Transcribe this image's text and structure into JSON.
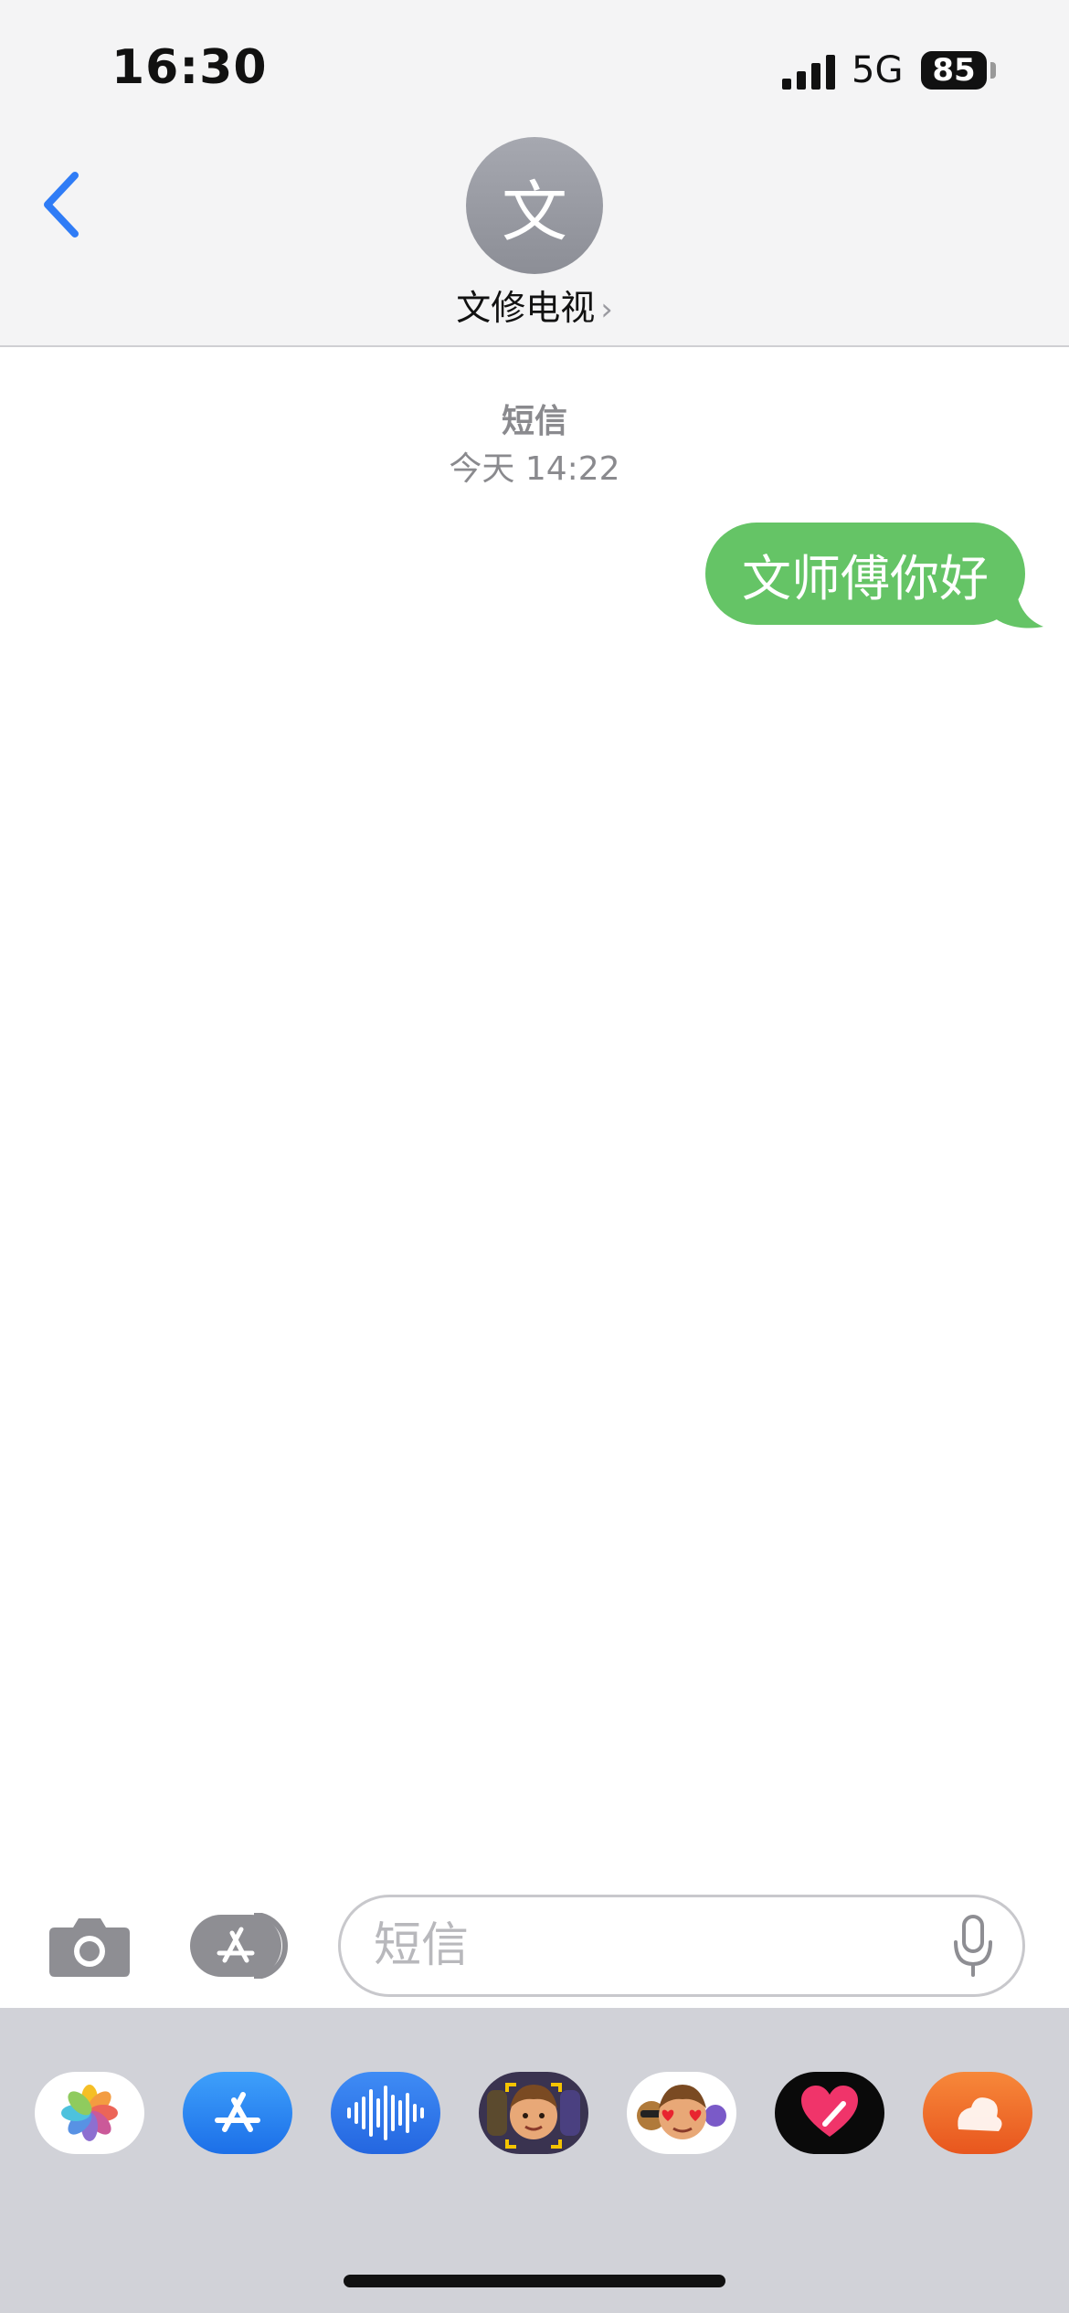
{
  "status": {
    "time": "16:30",
    "network": "5G",
    "battery": "85"
  },
  "contact": {
    "avatar_letter": "文",
    "name": "文修电视",
    "chevron": "›"
  },
  "thread": {
    "type": "短信",
    "timestamp": "今天 14:22"
  },
  "messages": [
    {
      "sender": "me",
      "text": "文师傅你好"
    }
  ],
  "composer": {
    "placeholder": "短信"
  },
  "app_drawer": [
    {
      "name": "photos-app",
      "icon": "photos-icon"
    },
    {
      "name": "app-store-app",
      "icon": "app-store-icon"
    },
    {
      "name": "audio-message-app",
      "icon": "waveform-icon"
    },
    {
      "name": "memoji-app",
      "icon": "memoji-icon"
    },
    {
      "name": "memoji-stickers-app",
      "icon": "memoji-stickers-icon"
    },
    {
      "name": "digital-touch-app",
      "icon": "heart-icon"
    },
    {
      "name": "more-app",
      "icon": "app-icon"
    }
  ],
  "colors": {
    "accent": "#2f7cf6",
    "bubble": "#65c466",
    "header_bg": "#f4f4f5",
    "drawer_bg": "#d1d2d8"
  }
}
